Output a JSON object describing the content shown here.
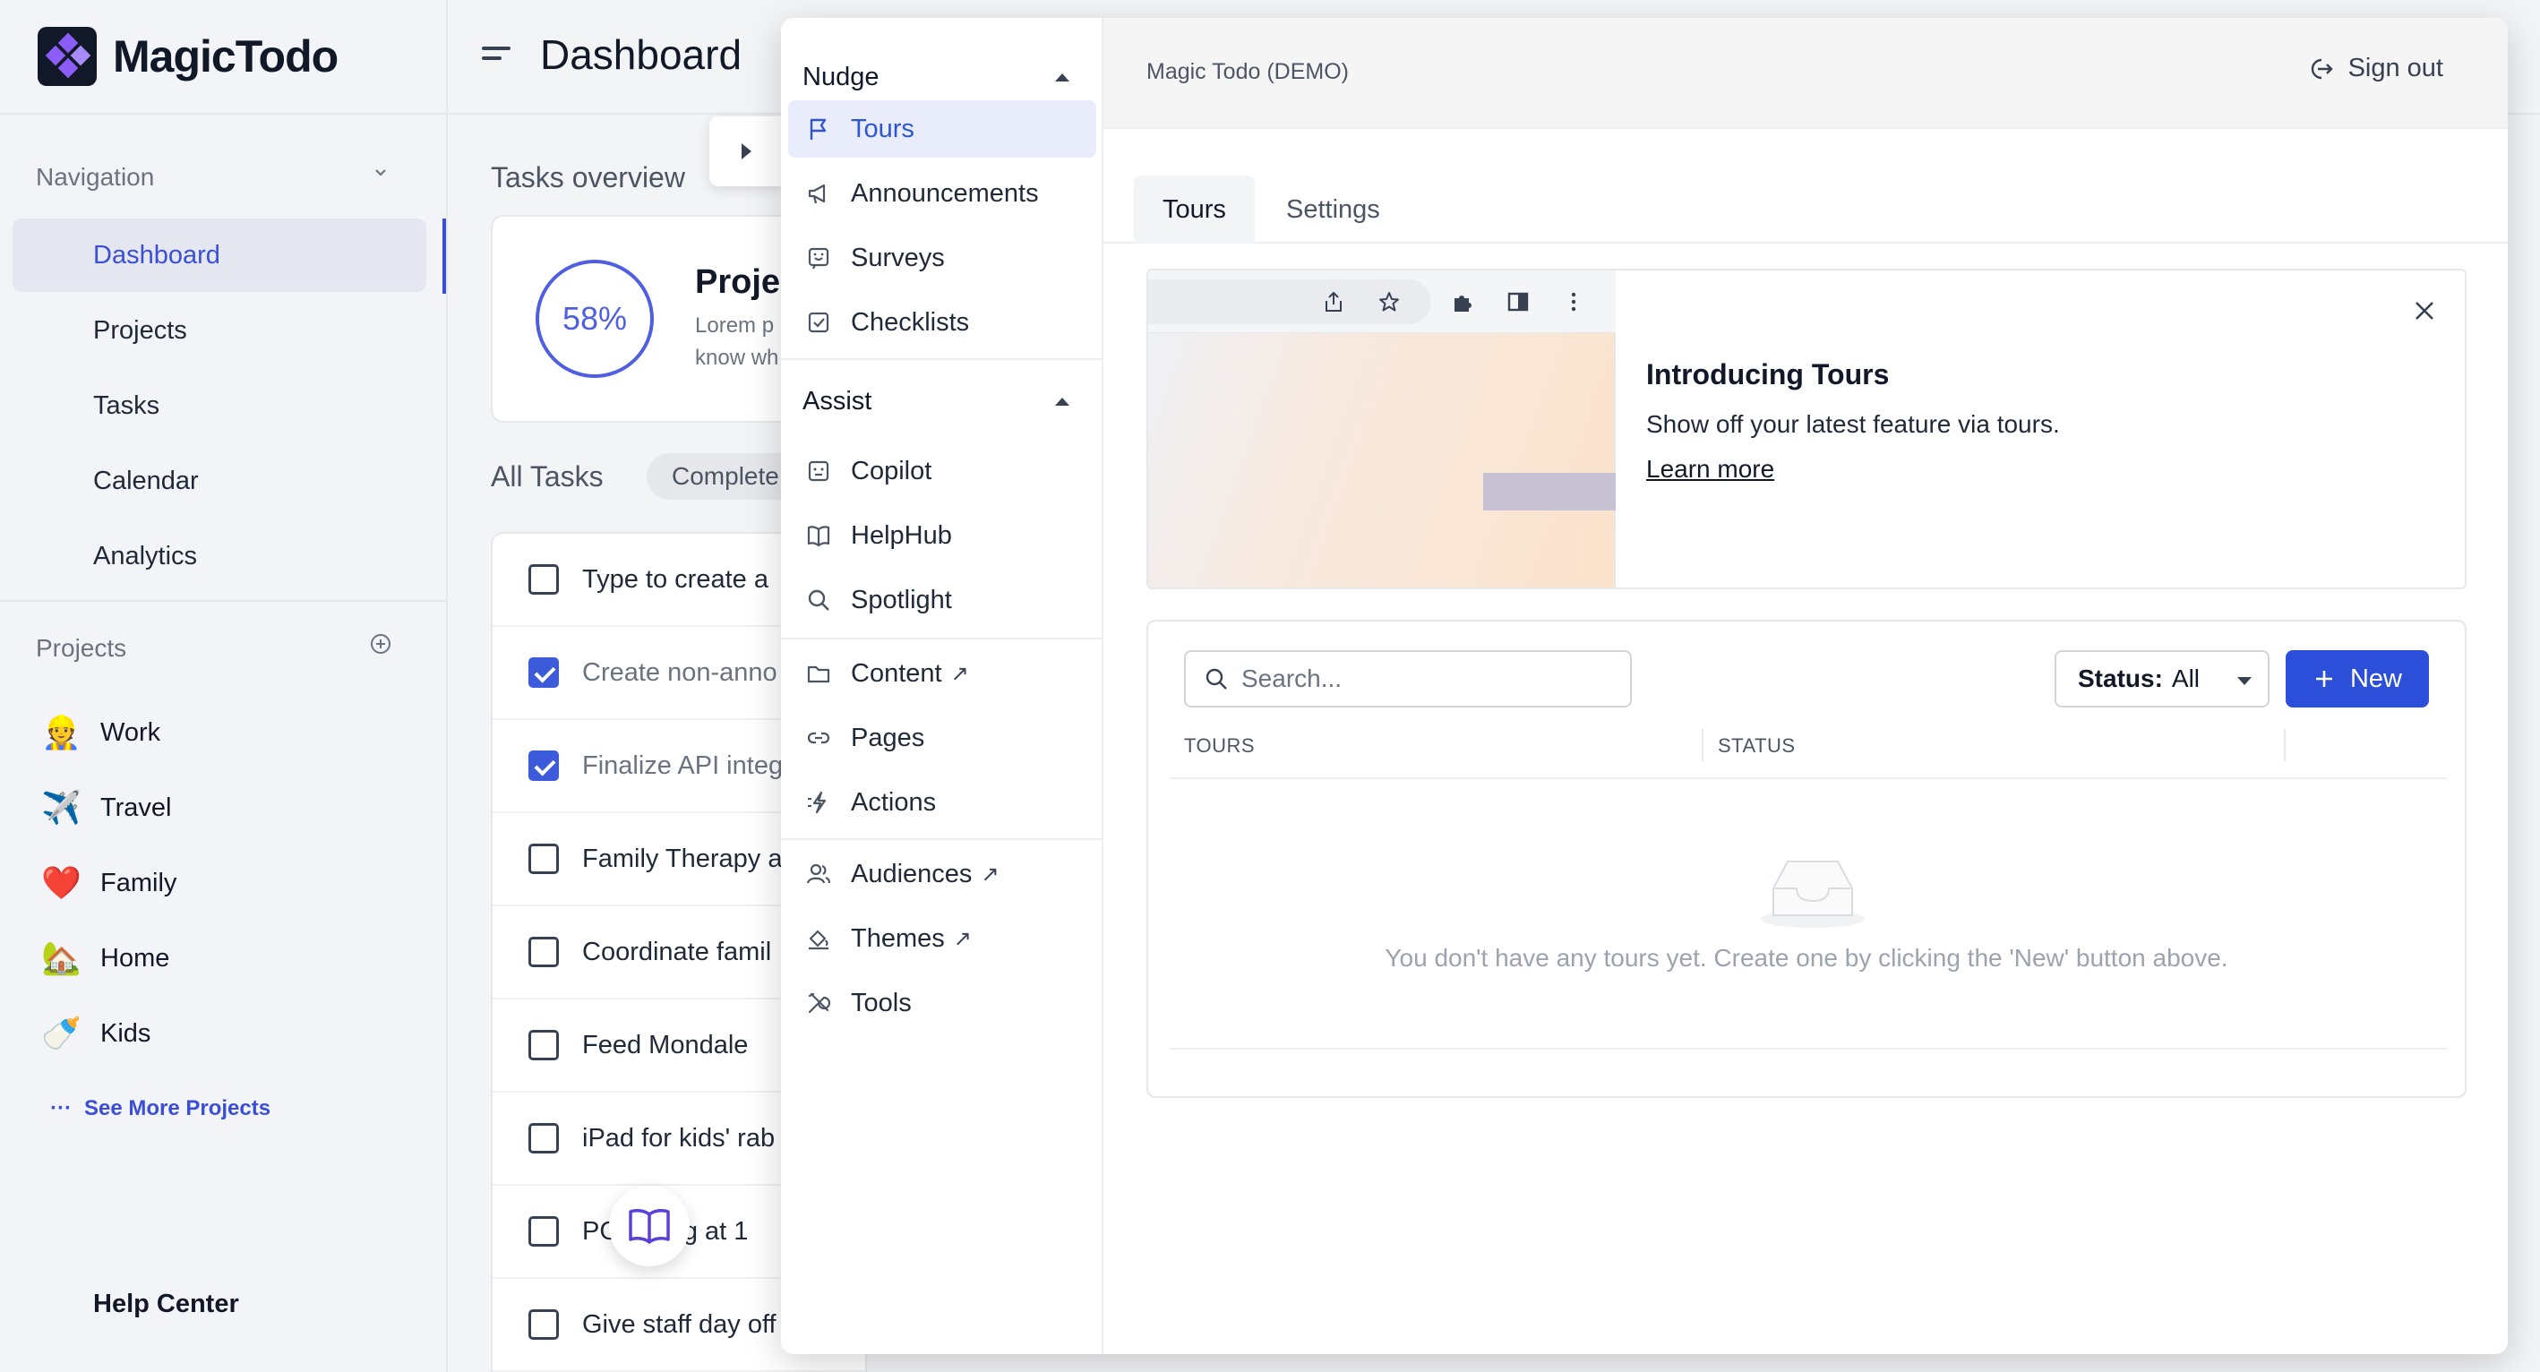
{
  "app": {
    "name": "MagicTodo",
    "page_title": "Dashboard"
  },
  "sidebar": {
    "navigation_title": "Navigation",
    "nav_items": [
      {
        "label": "Dashboard",
        "active": true
      },
      {
        "label": "Projects"
      },
      {
        "label": "Tasks"
      },
      {
        "label": "Calendar"
      },
      {
        "label": "Analytics"
      }
    ],
    "projects_title": "Projects",
    "projects": [
      {
        "label": "Work",
        "emoji": "👷"
      },
      {
        "label": "Travel",
        "emoji": "✈️"
      },
      {
        "label": "Family",
        "emoji": "❤️"
      },
      {
        "label": "Home",
        "emoji": "🏡"
      },
      {
        "label": "Kids",
        "emoji": "🍼"
      }
    ],
    "see_more": "See More Projects",
    "help_center": "Help Center"
  },
  "dashboard": {
    "tasks_overview": "Tasks overview",
    "progress_percent": "58%",
    "project_heading": "Proje",
    "project_desc_1": "Lorem p",
    "project_desc_2": "know wh",
    "all_tasks": "All Tasks",
    "completed_chip": "Complete",
    "tasks": [
      {
        "label": "Type to create a",
        "checked": false
      },
      {
        "label": "Create non-anno",
        "checked": true
      },
      {
        "label": "Finalize API integ",
        "checked": true
      },
      {
        "label": "Family Therapy a",
        "checked": false
      },
      {
        "label": "Coordinate famil",
        "checked": false
      },
      {
        "label": "Feed Mondale",
        "checked": false
      },
      {
        "label": "iPad for kids' rab",
        "checked": false
      },
      {
        "label": "PG     ting at 1",
        "checked": false
      },
      {
        "label": "Give staff day off",
        "checked": false
      }
    ]
  },
  "editor": {
    "env_label": "Magic Todo (DEMO)",
    "sign_out": "Sign out",
    "nudge_group": "Nudge",
    "nudge_items": [
      "Tours",
      "Announcements",
      "Surveys",
      "Checklists"
    ],
    "assist_group": "Assist",
    "assist_items": [
      "Copilot",
      "HelpHub",
      "Spotlight"
    ],
    "content_items": [
      "Content",
      "Pages",
      "Actions"
    ],
    "other_items": [
      "Audiences",
      "Themes",
      "Tools"
    ],
    "tabs": [
      "Tours",
      "Settings"
    ],
    "intro": {
      "title": "Introducing Tours",
      "description": "Show off your latest feature via tours.",
      "link": "Learn more"
    },
    "search_placeholder": "Search...",
    "status_label": "Status:",
    "status_value": "All",
    "new_button": "New",
    "columns": [
      "TOURS",
      "STATUS"
    ],
    "empty_message": "You don't have any tours yet. Create one by clicking the 'New' button above."
  },
  "colors": {
    "accent": "#2b4fd8",
    "active_nav_bg": "#e8ecfb",
    "sidebar_bg": "#f3f4f7"
  }
}
